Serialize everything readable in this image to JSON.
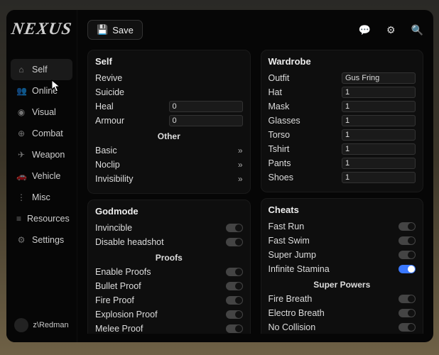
{
  "logo": "NEXUS",
  "save_label": "Save",
  "username": "z\\Redman",
  "nav": [
    {
      "icon": "⌂",
      "label": "Self",
      "active": true
    },
    {
      "icon": "👥",
      "label": "Online"
    },
    {
      "icon": "◉",
      "label": "Visual"
    },
    {
      "icon": "⊕",
      "label": "Combat"
    },
    {
      "icon": "✈",
      "label": "Weapon"
    },
    {
      "icon": "🚗",
      "label": "Vehicle"
    },
    {
      "icon": "⋮",
      "label": "Misc"
    },
    {
      "icon": "≡",
      "label": "Resources"
    },
    {
      "icon": "⚙",
      "label": "Settings"
    }
  ],
  "topicons": {
    "chat": "💬",
    "gear": "⚙",
    "search": "🔍"
  },
  "self": {
    "title": "Self",
    "revive": "Revive",
    "suicide": "Suicide",
    "heal": "Heal",
    "heal_val": "0",
    "armour": "Armour",
    "armour_val": "0",
    "other": "Other",
    "basic": "Basic",
    "noclip": "Noclip",
    "invis": "Invisibility"
  },
  "godmode": {
    "title": "Godmode",
    "invincible": "Invincible",
    "disable_headshot": "Disable headshot",
    "proofs": "Proofs",
    "enable": "Enable Proofs",
    "bullet": "Bullet Proof",
    "fire": "Fire Proof",
    "explosion": "Explosion Proof",
    "melee": "Melee Proof"
  },
  "wardrobe": {
    "title": "Wardrobe",
    "outfit": "Outfit",
    "outfit_val": "Gus Fring",
    "hat": "Hat",
    "hat_val": "1",
    "mask": "Mask",
    "mask_val": "1",
    "glasses": "Glasses",
    "glasses_val": "1",
    "torso": "Torso",
    "torso_val": "1",
    "tshirt": "Tshirt",
    "tshirt_val": "1",
    "pants": "Pants",
    "pants_val": "1",
    "shoes": "Shoes",
    "shoes_val": "1"
  },
  "cheats": {
    "title": "Cheats",
    "fastrun": "Fast Run",
    "fastswim": "Fast Swim",
    "superjump": "Super Jump",
    "stamina": "Infinite Stamina",
    "powers": "Super Powers",
    "firebreath": "Fire Breath",
    "electro": "Electro Breath",
    "nocoll": "No Collision"
  }
}
